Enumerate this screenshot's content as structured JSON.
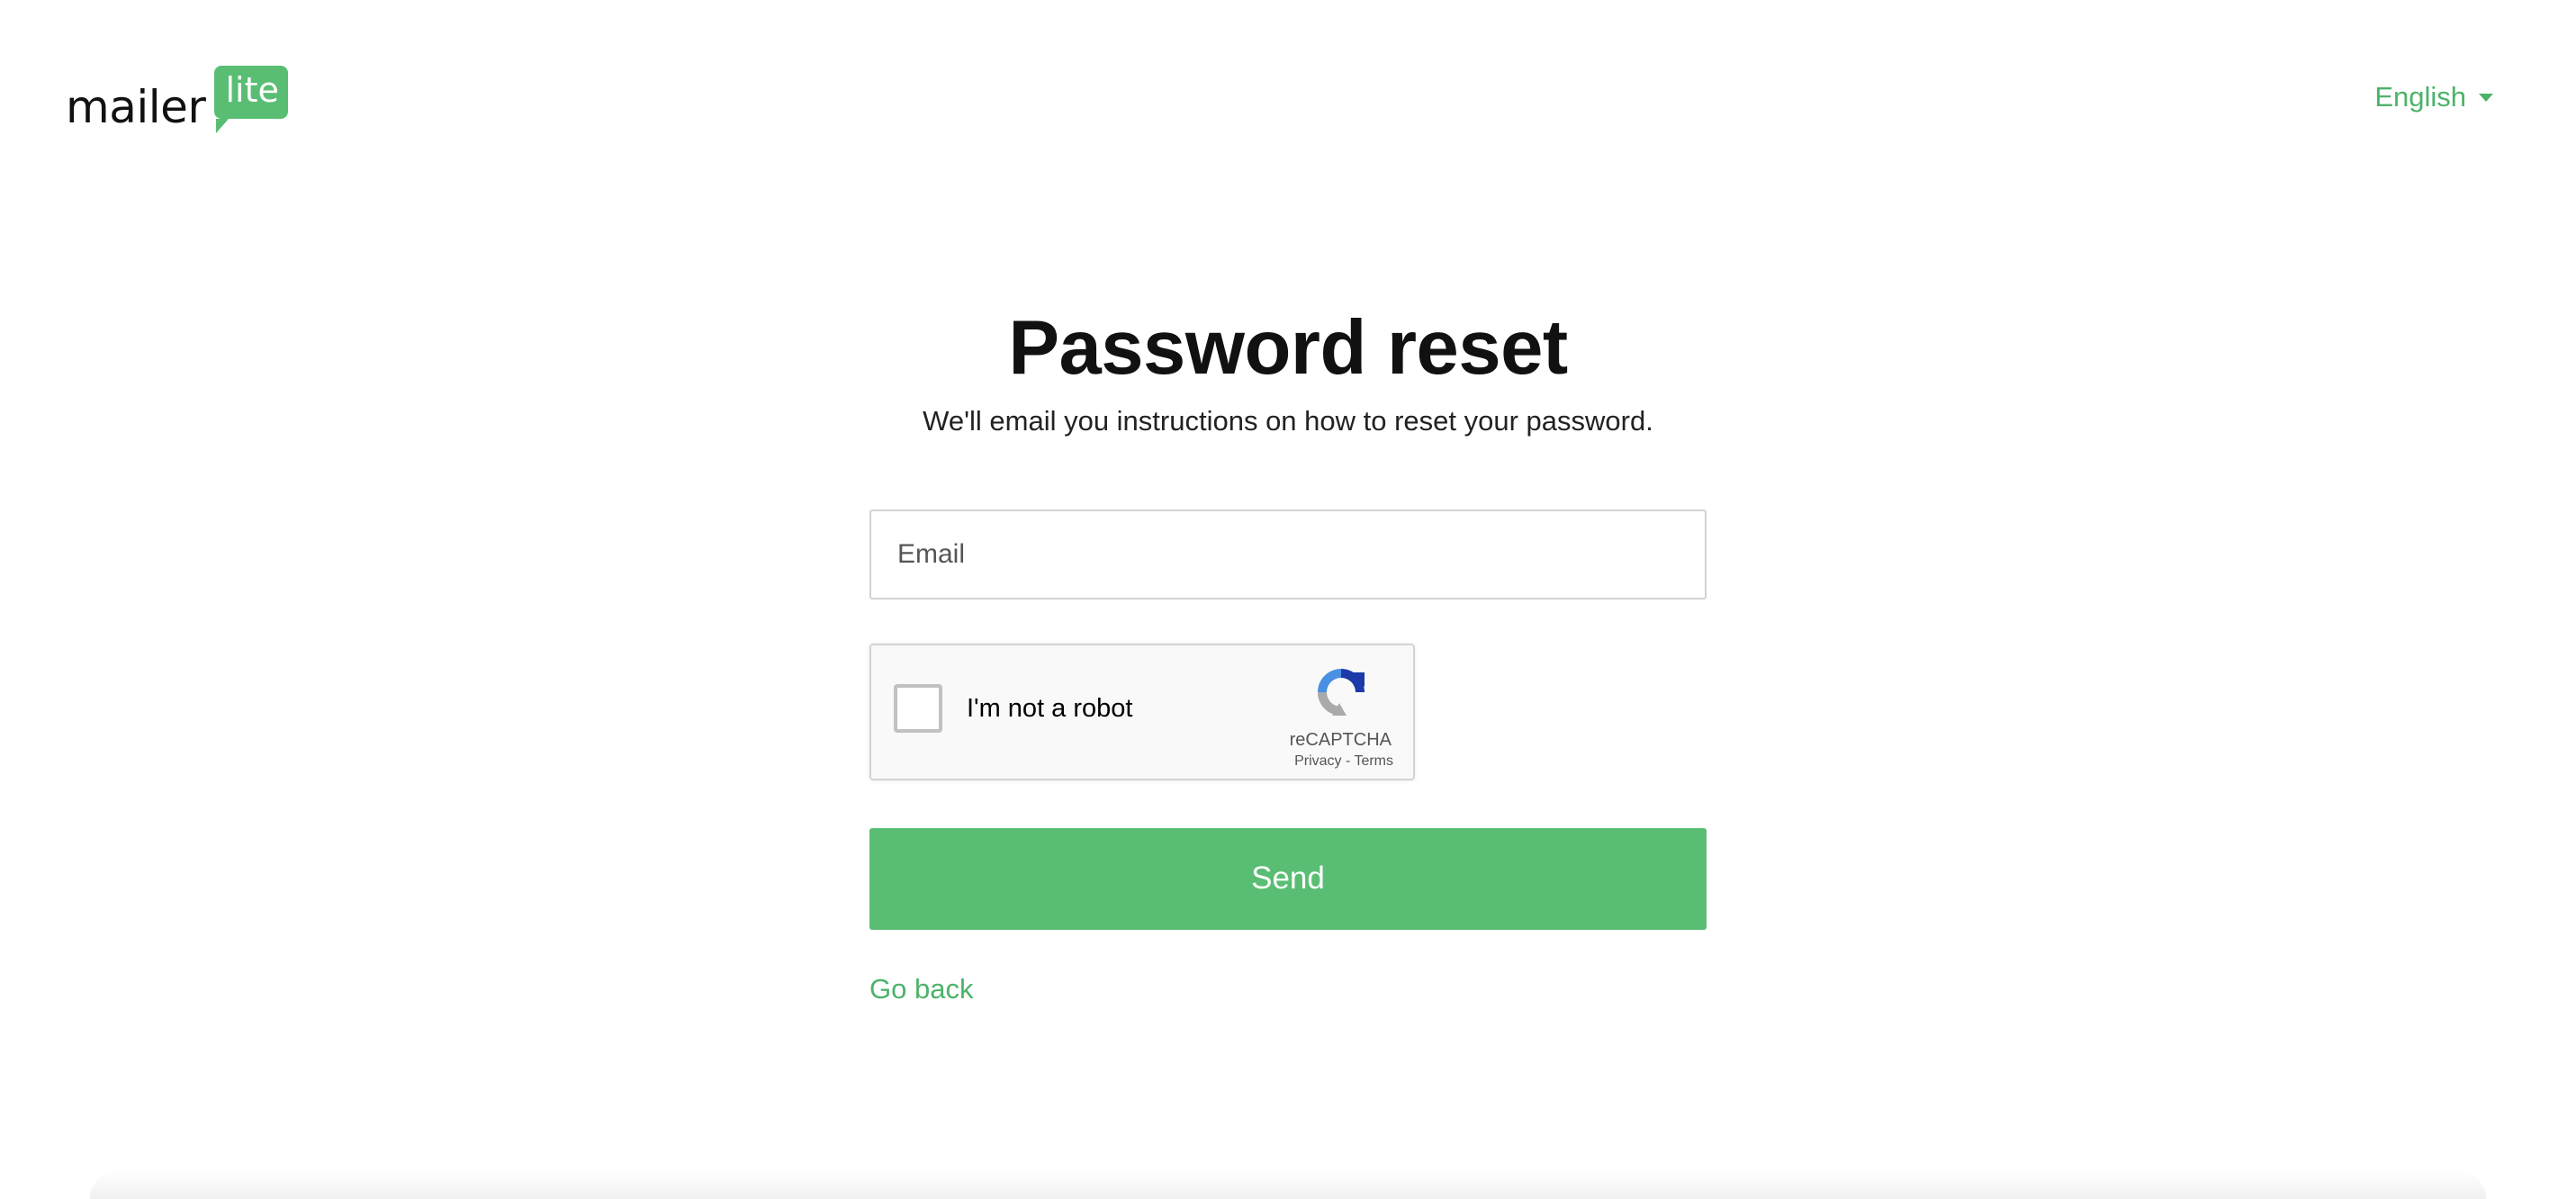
{
  "header": {
    "logo": {
      "word": "mailer",
      "bubble": "lite"
    },
    "language": {
      "selected": "English"
    }
  },
  "main": {
    "title": "Password reset",
    "subtitle": "We'll email you instructions on how to reset your password.",
    "email": {
      "placeholder": "Email",
      "value": ""
    },
    "captcha": {
      "label": "I'm not a robot",
      "brand": "reCAPTCHA",
      "links": "Privacy - Terms",
      "checked": false
    },
    "send_label": "Send",
    "go_back_label": "Go back"
  },
  "colors": {
    "accent": "#59be73",
    "link": "#4cb36a"
  }
}
